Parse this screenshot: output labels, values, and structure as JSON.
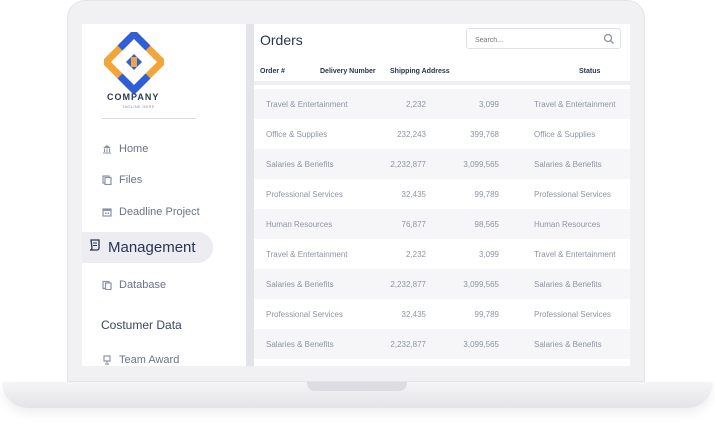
{
  "brand": {
    "name": "COMPANY",
    "tagline": "TAGLINE HERE",
    "primary_color": "#f2a53a",
    "secondary_color": "#2f5fd8"
  },
  "sidebar": {
    "items": [
      {
        "label": "Home",
        "icon": "bank-icon"
      },
      {
        "label": "Files",
        "icon": "files-icon"
      },
      {
        "label": "Deadline Project",
        "icon": "calendar-icon"
      },
      {
        "label": "Management",
        "icon": "scroll-icon",
        "active": true
      },
      {
        "label": "Database",
        "icon": "database-icon"
      }
    ],
    "section_heading": "Costumer Data",
    "section_items": [
      {
        "label": "Team Award",
        "icon": "award-icon"
      }
    ]
  },
  "main": {
    "title": "Orders",
    "search": {
      "placeholder": "Search..."
    },
    "columns": [
      "Order #",
      "Delivery Number",
      "Shipping Address",
      "Status"
    ],
    "rows": [
      {
        "category": "Travel & Entertainment",
        "delivery": "2,232",
        "shipping": "3,099",
        "status": "Travel & Entertainment"
      },
      {
        "category": "Office & Supplies",
        "delivery": "232,243",
        "shipping": "399,768",
        "status": "Office & Supplies"
      },
      {
        "category": "Salaries & Benefits",
        "delivery": "2,232,877",
        "shipping": "3,099,565",
        "status": "Salaries & Benefits"
      },
      {
        "category": "Professional Services",
        "delivery": "32,435",
        "shipping": "99,789",
        "status": "Professional Services"
      },
      {
        "category": "Human Resources",
        "delivery": "76,877",
        "shipping": "98,565",
        "status": "Human Resources"
      },
      {
        "category": "Travel & Entertainment",
        "delivery": "2,232",
        "shipping": "3,099",
        "status": "Travel & Entertainment"
      },
      {
        "category": "Salaries & Benefits",
        "delivery": "2,232,877",
        "shipping": "3,099,565",
        "status": "Salaries & Benefits"
      },
      {
        "category": "Professional Services",
        "delivery": "32,435",
        "shipping": "99,789",
        "status": "Professional Services"
      },
      {
        "category": "Salaries & Benefits",
        "delivery": "2,232,877",
        "shipping": "3,099,565",
        "status": "Salaries & Benefits"
      }
    ]
  }
}
